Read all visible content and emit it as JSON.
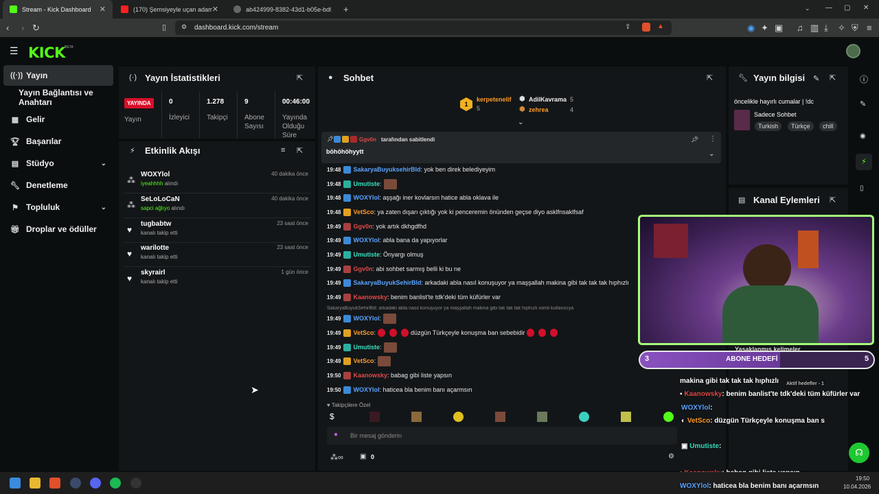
{
  "browser": {
    "tabs": [
      {
        "title": "Stream - Kick Dashboard",
        "color": "#53fc18"
      },
      {
        "title": "(170) Şemsiyeyle uçan adam - YouTube",
        "color": "#ff2020"
      },
      {
        "title": "ab424999-8382-43d1-b05e-bd0c2e7",
        "color": "#888888"
      }
    ],
    "new_tab": "+",
    "url": "dashboard.kick.com/stream"
  },
  "brand": {
    "logo": "KICK",
    "beta": "BETA",
    "accent": "#53fc18"
  },
  "sidebar": {
    "items": [
      {
        "label": "Yayın",
        "icon": "broadcast-icon"
      },
      {
        "label": "Yayın Bağlantısı ve Anahtarı",
        "icon": ""
      },
      {
        "label": "Gelir",
        "icon": "revenue-icon"
      },
      {
        "label": "Başarılar",
        "icon": "trophy-icon"
      },
      {
        "label": "Stüdyo",
        "icon": "studio-icon"
      },
      {
        "label": "Denetleme",
        "icon": "wrench-icon"
      },
      {
        "label": "Topluluk",
        "icon": "community-icon"
      },
      {
        "label": "Droplar ve ödüller",
        "icon": "gift-icon"
      }
    ]
  },
  "stats": {
    "title": "Yayın İstatistikleri",
    "live_badge": "YAYINDA",
    "live_label": "Yayın",
    "columns": [
      {
        "value": "0",
        "label": "İzleyici"
      },
      {
        "value": "1.278",
        "label": "Takipçi"
      },
      {
        "value": "9",
        "label": "Abone Sayısı"
      },
      {
        "value": "00:46:00",
        "label": "Yayında Olduğu Süre"
      }
    ]
  },
  "activity": {
    "title": "Etkinlik Akışı",
    "items": [
      {
        "name": "WOXYlol",
        "highlight": "iyeahhhh",
        "action": "alındı",
        "time": "40 dakika önce",
        "icon": "reward-icon"
      },
      {
        "name": "SeLoLoCaN",
        "highlight": "sapci ağlıyo",
        "action": "alındı",
        "time": "40 dakika önce",
        "icon": "reward-icon"
      },
      {
        "name": "tugbabtw",
        "highlight": "",
        "action": "kanalı takip etti",
        "time": "23 saat önce",
        "icon": "heart-icon"
      },
      {
        "name": "warilotte",
        "highlight": "",
        "action": "kanalı takip etti",
        "time": "23 saat önce",
        "icon": "heart-icon"
      },
      {
        "name": "skyrairl",
        "highlight": "",
        "action": "kanalı takip etti",
        "time": "1 gün önce",
        "icon": "heart-icon"
      }
    ]
  },
  "chat": {
    "title": "Sohbet",
    "leaderboard": [
      {
        "rank": "1",
        "name": "kerpetenelif",
        "count": "5"
      },
      {
        "name": "AdilKavrama",
        "count": "5"
      },
      {
        "name": "zehrea",
        "count": "4"
      }
    ],
    "pinned": {
      "user": "Ggv0n",
      "by_text": "tarafından sabitlendi",
      "text": "böhöhöhyytt"
    },
    "messages": [
      {
        "time": "19:48",
        "user": "SakaryaBuyuksehirBld",
        "color": "c-blue",
        "text": ": yok ben direk belediyeyim",
        "emotes": 0
      },
      {
        "time": "19:48",
        "user": "Umutiste",
        "color": "c-teal",
        "text": ":",
        "emotes": 1
      },
      {
        "time": "19:48",
        "user": "WOXYlol",
        "color": "c-blue",
        "text": ": aşşağı iner kovlarsın hatice abla oklava ile",
        "emotes": 0
      },
      {
        "time": "19:48",
        "user": "VetSco",
        "color": "c-orange",
        "text": ": ya zaten dışarı çıktığı yok ki penceremin önünden geçse diyo asklfnsaklfsaf",
        "emotes": 0
      },
      {
        "time": "19:49",
        "user": "Ggv0n",
        "color": "c-red",
        "text": ": yok artık dkhgdfhd",
        "emotes": 0
      },
      {
        "time": "19:49",
        "user": "WOXYlol",
        "color": "c-blue",
        "text": ": abla bana da yapıyorlar",
        "emotes": 0
      },
      {
        "time": "19:49",
        "user": "Umutiste",
        "color": "c-teal",
        "text": ": Önyargı olmuş",
        "emotes": 0
      },
      {
        "time": "19:49",
        "user": "Ggv0n",
        "color": "c-red",
        "text": ": abi sohbet sarmış belli ki bu ne",
        "emotes": 0
      },
      {
        "time": "19:49",
        "user": "SakaryaBuyukSehirBld",
        "color": "c-blue",
        "text": ": arkadaki abla nasıl konuşuyor ya maşşallah makina gibi tak tak tak hıphızlı",
        "emotes": 0
      },
      {
        "time": "19:49",
        "user": "Kaanowsky",
        "color": "c-red",
        "text": ": benim banlist'te tdk'deki tüm küfürler var",
        "emotes": 0
      }
    ],
    "reply_ref": "SakaryaBuyukSehirBld: arkadaki abla nasıl konuşuyor ya maşşallah makina gibi tak tak tak hıphızlı isimli kullanıcıya",
    "messages2": [
      {
        "time": "19:49",
        "user": "WOXYlol",
        "color": "c-blue",
        "text": ":",
        "emotes": 1
      },
      {
        "time": "19:49",
        "user": "VetSco",
        "color": "c-orange",
        "text": ":",
        "hearts_before": 3,
        "after": "düzgün Türkçeyle konuşma ban sebebidir",
        "hearts_after": 3
      },
      {
        "time": "19:49",
        "user": "Umutiste",
        "color": "c-teal",
        "text": ":",
        "emotes": 1
      },
      {
        "time": "19:49",
        "user": "VetSco",
        "color": "c-orange",
        "text": ":",
        "emotes": 1
      },
      {
        "time": "19:50",
        "user": "Kaanowsky",
        "color": "c-red",
        "text": ": babag gibi liste yapsın",
        "emotes": 0
      },
      {
        "time": "19:50",
        "user": "WOXYlol",
        "color": "c-blue",
        "text": ": haticea bla benim banı açarmsın",
        "emotes": 0
      }
    ],
    "followers_only": "Takipçilere Özel",
    "input_placeholder": "Bir mesaj gönderin",
    "footer_count": "0"
  },
  "stream_info": {
    "title": "Yayın bilgisi",
    "stream_title": "öncelikle hayırlı cumalar | !dc",
    "category": "Sadece Sohbet",
    "tags": [
      "Turkish",
      "Türkçe",
      "chill"
    ]
  },
  "channel_actions": {
    "title": "Kanal Eylemleri"
  },
  "overlay": {
    "goal_left": "3",
    "goal_label": "ABONE HEDEFİ",
    "goal_right": "5",
    "goal_progress": 0.6,
    "banned_words": "Yasaklanmış kelimeler",
    "active_goals": "Aktif hedefler - 1",
    "lines": [
      {
        "user": "",
        "text": "makina gibi tak tak tak hıphızlı"
      },
      {
        "user": "Kaanowsky",
        "text": ": benim banlist'te tdk'deki tüm küfürler var"
      },
      {
        "user": "WOXYlol",
        "text": ":"
      },
      {
        "user": "VetSco",
        "text": ": düzgün Türkçeyle konuşma ban s"
      },
      {
        "user": "Umutiste",
        "text": ":"
      },
      {
        "user": "Kaanowsky",
        "text": ": babag gibi liste yapsın"
      },
      {
        "user": "WOXYlol",
        "text": ": haticea bla benim banı açarmsın"
      }
    ]
  },
  "taskbar": {
    "time": "19:50",
    "date": "10.04.2026"
  }
}
